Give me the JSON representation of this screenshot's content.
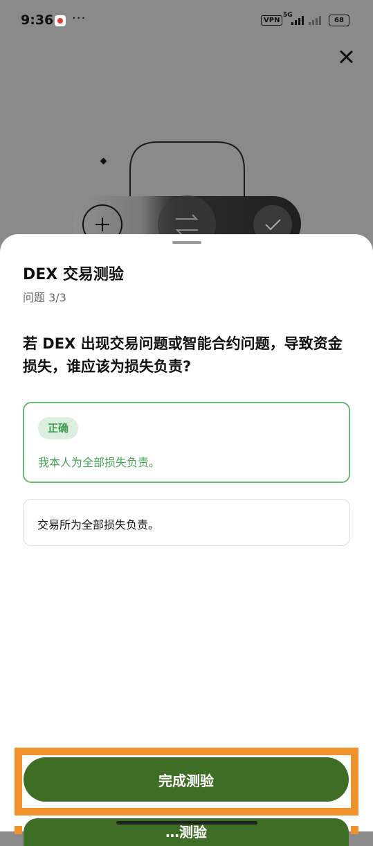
{
  "status_bar": {
    "time": "9:36",
    "more": "···",
    "vpn": "VPN",
    "network": "5G",
    "battery": "68"
  },
  "quiz": {
    "title": "DEX 交易测验",
    "progress": "问题 3/3",
    "question": "若 DEX 出现交易问题或智能合约问题，导致资金损失，谁应该为损失负责?",
    "options": [
      {
        "badge": "正确",
        "text": "我本人为全部损失负责。",
        "state": "correct"
      },
      {
        "text": "交易所为全部损失负责。",
        "state": "unselected"
      }
    ],
    "finish_button": "完成测验",
    "next_button_partial": "…测验"
  },
  "colors": {
    "accent_green": "#3e6d25",
    "correct_green": "#47a35a",
    "highlight_orange": "#f0912e"
  },
  "icons": {
    "close": "close-icon",
    "plus": "plus-icon",
    "swap": "swap-arrows-icon",
    "check": "checkmark-icon"
  }
}
